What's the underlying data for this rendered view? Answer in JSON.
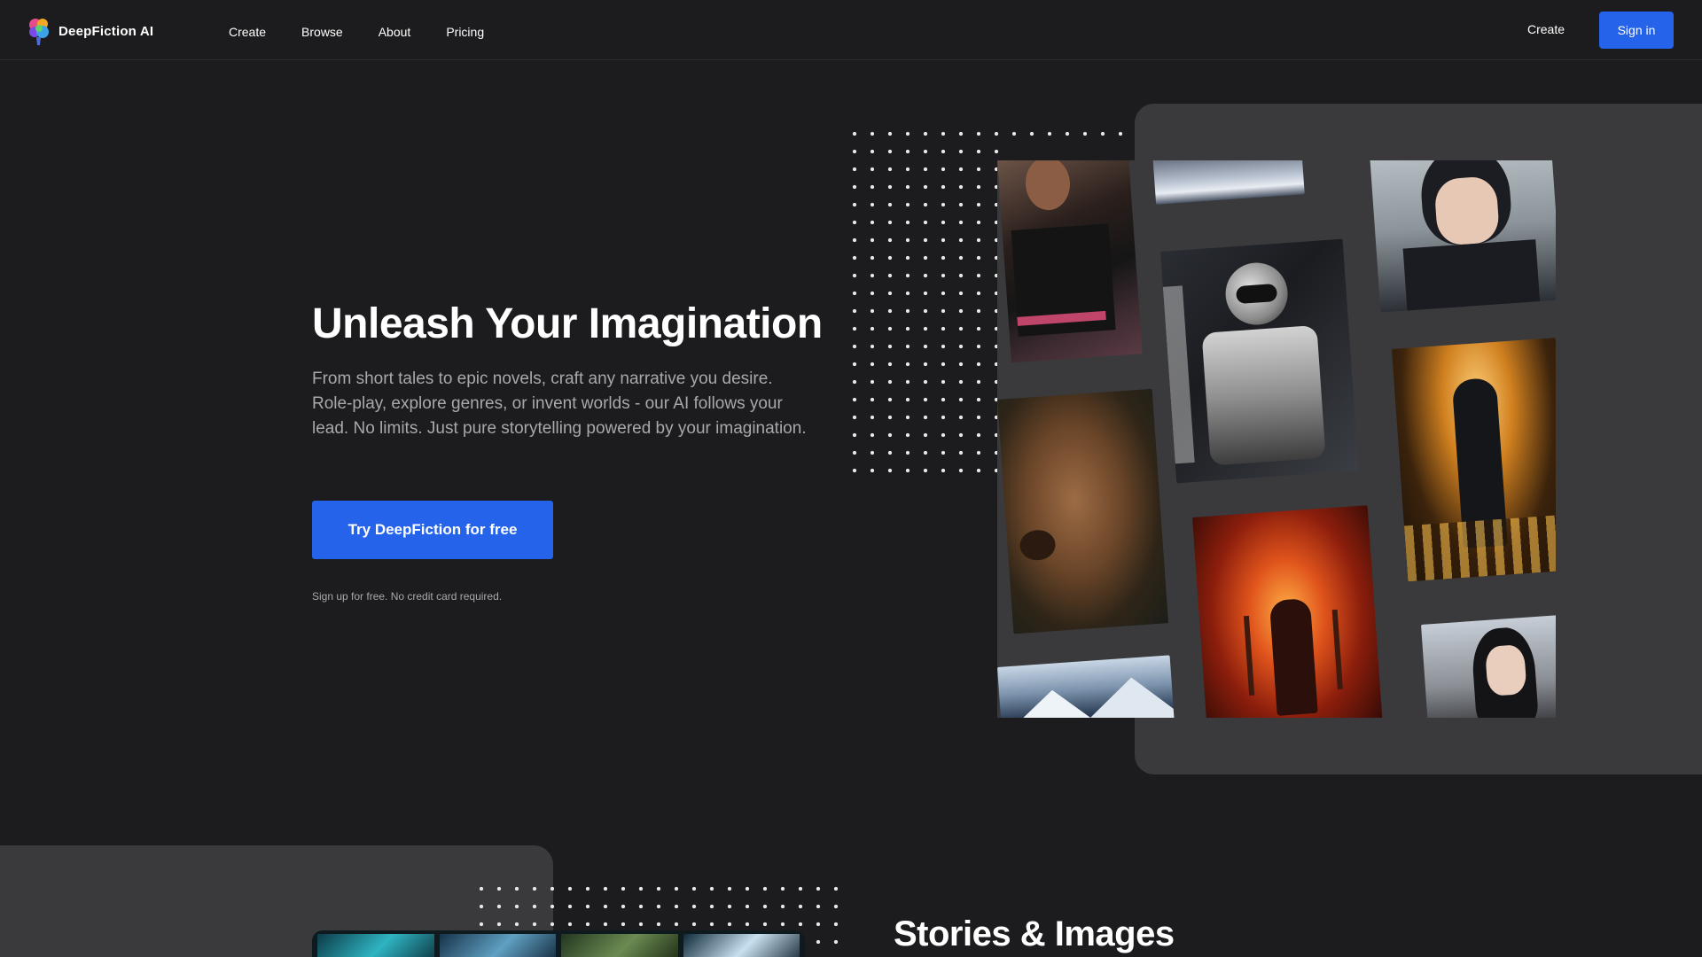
{
  "brand": {
    "name": "DeepFiction AI",
    "logo": "brain-logo-icon"
  },
  "nav": {
    "links": [
      "Create",
      "Browse",
      "About",
      "Pricing"
    ],
    "create_label": "Create",
    "signin_label": "Sign in"
  },
  "hero": {
    "title": "Unleash Your Imagination",
    "description": "From short tales to epic novels, craft any narrative you desire. Role-play, explore genres, or invent worlds - our AI follows your lead. No limits. Just pure storytelling powered by your imagination.",
    "cta_label": "Try DeepFiction for free",
    "note": "Sign up for free. No credit card required."
  },
  "colors": {
    "accent": "#2563eb",
    "background": "#1c1c1e",
    "panel": "#3a3a3c"
  },
  "gallery": {
    "tiles": [
      "anime-women-uniform-image",
      "snowy-clouds-image",
      "anime-girl-portrait-image",
      "astronaut-suit-image",
      "brown-bear-image",
      "dark-knight-hall-image",
      "fire-sorcerer-image",
      "snowy-mountains-image",
      "dark-hair-woman-image"
    ]
  },
  "section2": {
    "title": "Stories & Images"
  }
}
